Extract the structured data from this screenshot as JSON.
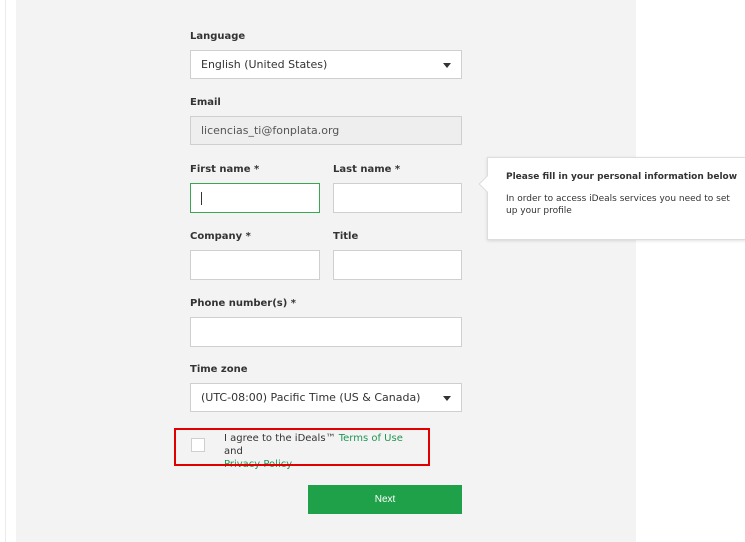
{
  "form": {
    "language": {
      "label": "Language",
      "value": "English (United States)"
    },
    "email": {
      "label": "Email",
      "value": "licencias_ti@fonplata.org"
    },
    "first_name": {
      "label": "First name *",
      "value": ""
    },
    "last_name": {
      "label": "Last name *",
      "value": ""
    },
    "company": {
      "label": "Company *",
      "value": ""
    },
    "title": {
      "label": "Title",
      "value": ""
    },
    "phone": {
      "label": "Phone number(s) *",
      "value": ""
    },
    "time_zone": {
      "label": "Time zone",
      "value": "(UTC-08:00) Pacific Time (US & Canada)"
    },
    "agree": {
      "prefix": "I agree to the iDeals™ ",
      "terms_link": "Terms of Use",
      "middle": " and",
      "privacy_link": "Privacy Policy"
    },
    "next_label": "Next"
  },
  "tooltip": {
    "title": "Please fill in your personal information below",
    "body": "In order to access iDeals services you need to set up your profile"
  },
  "colors": {
    "accent": "#1fa14a",
    "link": "#219653",
    "highlight": "#e00000",
    "focus": "#3aa655"
  }
}
